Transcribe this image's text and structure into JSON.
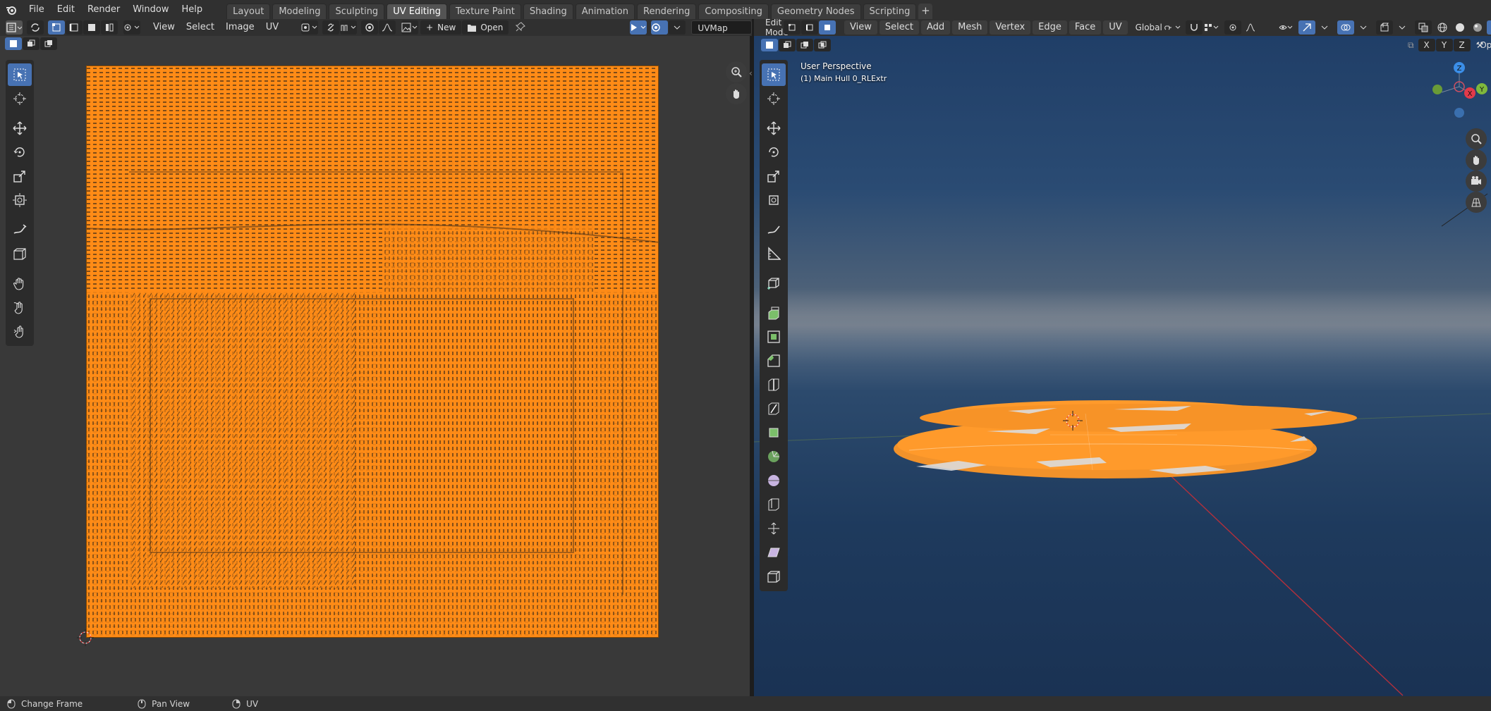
{
  "menubar": {
    "items": [
      "File",
      "Edit",
      "Render",
      "Window",
      "Help"
    ]
  },
  "workspaces": {
    "tabs": [
      "Layout",
      "Modeling",
      "Sculpting",
      "UV Editing",
      "Texture Paint",
      "Shading",
      "Animation",
      "Rendering",
      "Compositing",
      "Geometry Nodes",
      "Scripting"
    ],
    "active": "UV Editing",
    "add_label": "+"
  },
  "uv_editor": {
    "menus": [
      "View",
      "Select",
      "Image",
      "UV"
    ],
    "new_label": "New",
    "open_label": "Open",
    "uvmap_name": "UVMap"
  },
  "viewport": {
    "mode": "Edit Mode",
    "menus": [
      "View",
      "Select",
      "Add",
      "Mesh",
      "Vertex",
      "Edge",
      "Face",
      "UV"
    ],
    "transform_orientation": "Global",
    "options_label": "Options",
    "axis_lock": [
      "X",
      "Y",
      "Z"
    ],
    "overlay_title": "User Perspective",
    "overlay_object": "(1) Main Hull 0_RLExtr",
    "gizmo_axes": {
      "x": "X",
      "y": "Y",
      "z": "Z"
    }
  },
  "statusbar": {
    "items": [
      "Change Frame",
      "Pan View",
      "UV"
    ]
  },
  "colors": {
    "accent": "#4772b3",
    "uv_selected": "#ff8b16",
    "axis_x": "#e23a4a",
    "axis_y": "#7fb83c",
    "axis_z": "#3b8ee8"
  }
}
